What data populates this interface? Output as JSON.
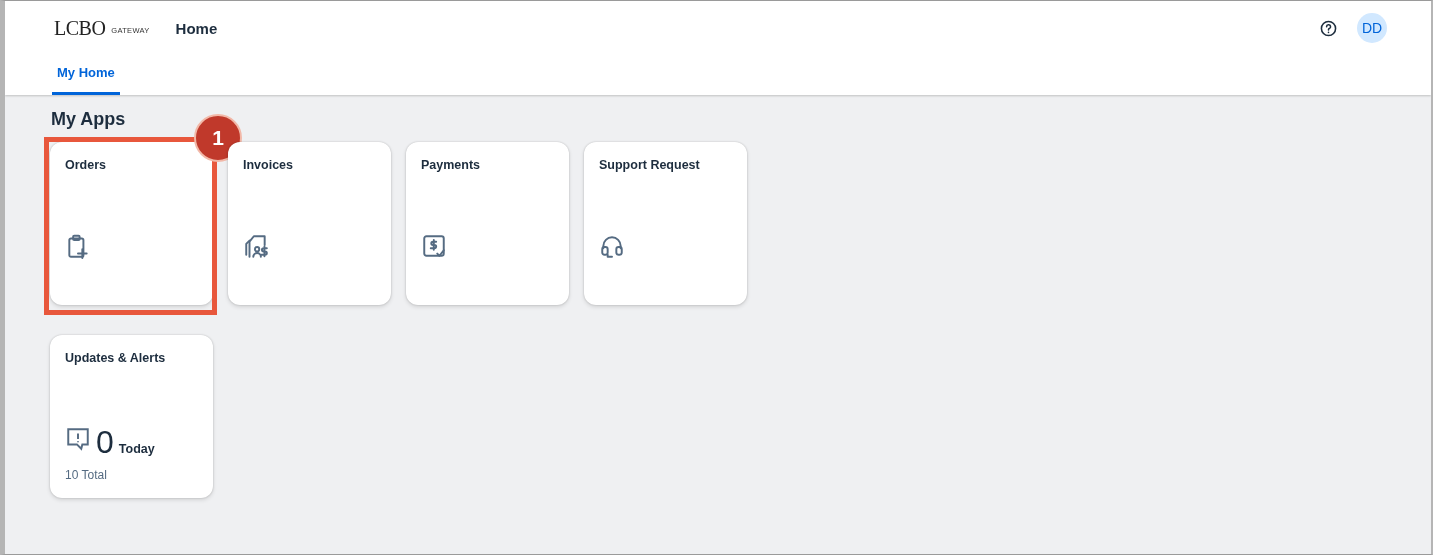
{
  "header": {
    "logo": "LCBO",
    "logo_sub": "GATEWAY",
    "title": "Home",
    "avatar": "DD"
  },
  "tabs": [
    {
      "label": "My Home",
      "selected": true
    }
  ],
  "section_title": "My Apps",
  "tiles": [
    {
      "kind": "app",
      "title": "Orders",
      "callout": "1"
    },
    {
      "kind": "app",
      "title": "Invoices"
    },
    {
      "kind": "app",
      "title": "Payments"
    },
    {
      "kind": "app",
      "title": "Support Request"
    },
    {
      "kind": "counter",
      "title": "Updates & Alerts",
      "count": "0",
      "count_label": "Today",
      "footer": "10 Total"
    }
  ]
}
